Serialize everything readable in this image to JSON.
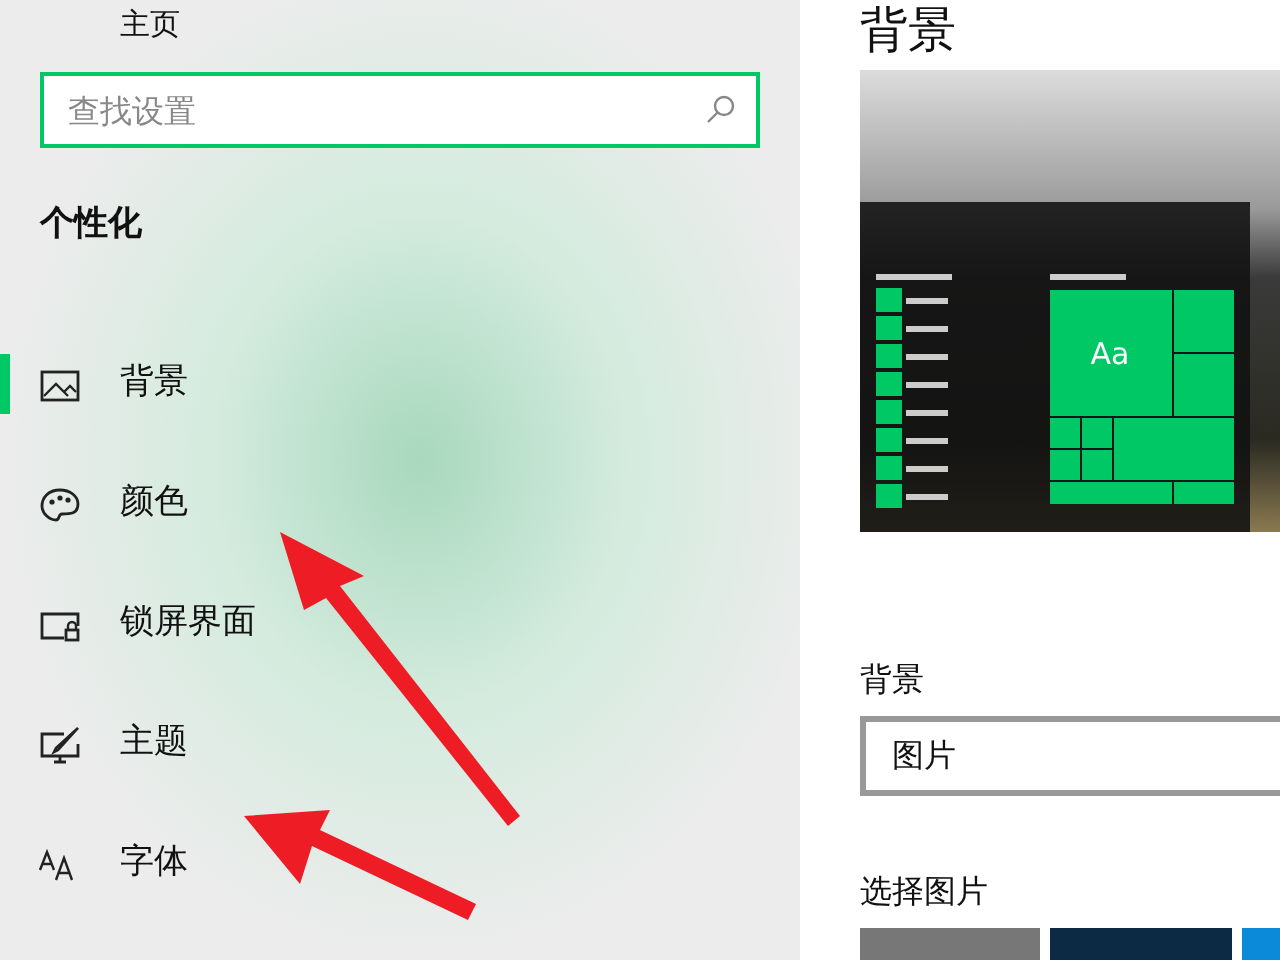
{
  "sidebar": {
    "home": "主页",
    "search": {
      "placeholder": "查找设置"
    },
    "section_title": "个性化",
    "items": [
      {
        "label": "背景",
        "selected": true
      },
      {
        "label": "颜色",
        "selected": false
      },
      {
        "label": "锁屏界面",
        "selected": false
      },
      {
        "label": "主题",
        "selected": false
      },
      {
        "label": "字体",
        "selected": false
      }
    ]
  },
  "main": {
    "title": "背景",
    "preview_tile_text": "Aa",
    "background_label": "背景",
    "background_value": "图片",
    "choose_picture_label": "选择图片"
  }
}
